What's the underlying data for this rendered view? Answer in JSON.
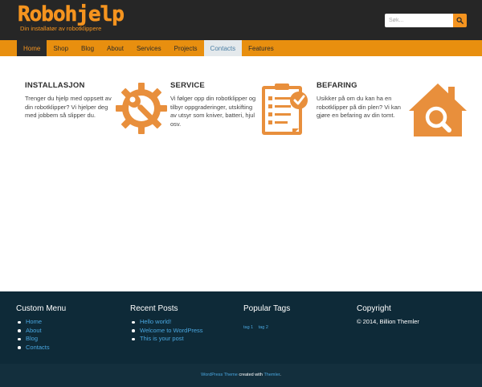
{
  "brand": {
    "name": "Robohjelp",
    "tagline": "Din installatør av robotklippere",
    "color": "#f5941f"
  },
  "search": {
    "placeholder": "Søk..."
  },
  "nav": {
    "items": [
      {
        "label": "Home"
      },
      {
        "label": "Shop"
      },
      {
        "label": "Blog"
      },
      {
        "label": "About"
      },
      {
        "label": "Services"
      },
      {
        "label": "Projects"
      },
      {
        "label": "Contacts"
      },
      {
        "label": "Features"
      }
    ]
  },
  "features": [
    {
      "title": "INSTALLASJON",
      "text": "Trenger du hjelp med oppsett av din robotklipper? Vi hjelper deg med jobbem så slipper du.",
      "icon": "none"
    },
    {
      "title": "SERVICE",
      "text": "Vi følger opp din robotklipper og tilbyr oppgraderinger, utskifting av utsyr som kniver, batteri, hjul osv.",
      "icon": "gear-wrench-icon"
    },
    {
      "title": "BEFARING",
      "text": "Usikker på om du kan ha en robotklipper på din plen? Vi kan gjøre en befaring av din tomt.",
      "icon": "checklist-icon"
    }
  ],
  "footer": {
    "menu": {
      "title": "Custom Menu",
      "items": [
        "Home",
        "About",
        "Blog",
        "Contacts"
      ]
    },
    "posts": {
      "title": "Recent Posts",
      "items": [
        "Hello world!",
        "Welcome to WordPress",
        "This is your post"
      ]
    },
    "tags": {
      "title": "Popular Tags",
      "items": [
        "tag 1",
        "tag 2"
      ]
    },
    "copyright": {
      "title": "Copyright",
      "text": "© 2014, Billion Themler"
    }
  },
  "credit": {
    "theme_link": "WordPress Theme",
    "middle": " created with ",
    "themler_link": "Themler",
    "end": "."
  }
}
